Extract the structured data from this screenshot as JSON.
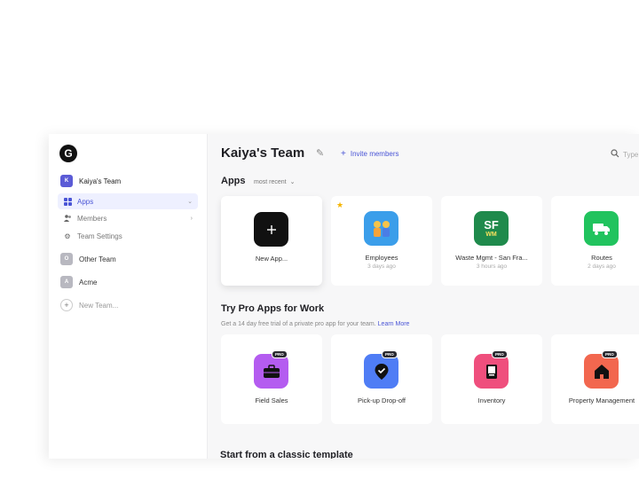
{
  "sidebar": {
    "logo": "G",
    "current_team": {
      "initial": "K",
      "name": "Kaiya's Team",
      "color": "#5b5bd6"
    },
    "nav": [
      {
        "label": "Apps",
        "icon": "grid-icon",
        "active": true
      },
      {
        "label": "Members",
        "icon": "people-icon",
        "active": false
      },
      {
        "label": "Team Settings",
        "icon": "gear-icon",
        "active": false
      }
    ],
    "other_teams": [
      {
        "initial": "O",
        "name": "Other Team",
        "color": "#b8b8c0"
      },
      {
        "initial": "A",
        "name": "Acme",
        "color": "#b8b8c0"
      }
    ],
    "new_team_label": "New Team..."
  },
  "header": {
    "title": "Kaiya's Team",
    "invite_label": "Invite members",
    "search_placeholder": "Type"
  },
  "apps_section": {
    "title": "Apps",
    "sort_label": "most recent",
    "cards": [
      {
        "label": "New App...",
        "sub": "",
        "icon": "plus-icon",
        "color": "#111111"
      },
      {
        "label": "Employees",
        "sub": "3 days ago",
        "icon": "people-emoji-icon",
        "color": "#3b9eea",
        "starred": true
      },
      {
        "label": "Waste Mgmt - San Fra...",
        "sub": "3 hours ago",
        "icon": "sf-wm-icon",
        "color": "#1f8a4c",
        "icon_text": "SF",
        "icon_text2": "WM"
      },
      {
        "label": "Routes",
        "sub": "2 days ago",
        "icon": "truck-icon",
        "color": "#21c35e"
      }
    ]
  },
  "pro_section": {
    "title": "Try Pro Apps for Work",
    "subtitle": "Get a 14 day free trial of a private pro app for your team.",
    "learn_more": "Learn More",
    "badge": "PRO",
    "cards": [
      {
        "label": "Field Sales",
        "icon": "briefcase-icon",
        "color": "#b45cf0"
      },
      {
        "label": "Pick-up Drop-off",
        "icon": "map-pin-check-icon",
        "color": "#4f7df5"
      },
      {
        "label": "Inventory",
        "icon": "book-icon",
        "color": "#ef4f7d"
      },
      {
        "label": "Property Management",
        "icon": "house-icon",
        "color": "#f2674f"
      }
    ]
  },
  "template_section": {
    "title": "Start from a classic template"
  }
}
